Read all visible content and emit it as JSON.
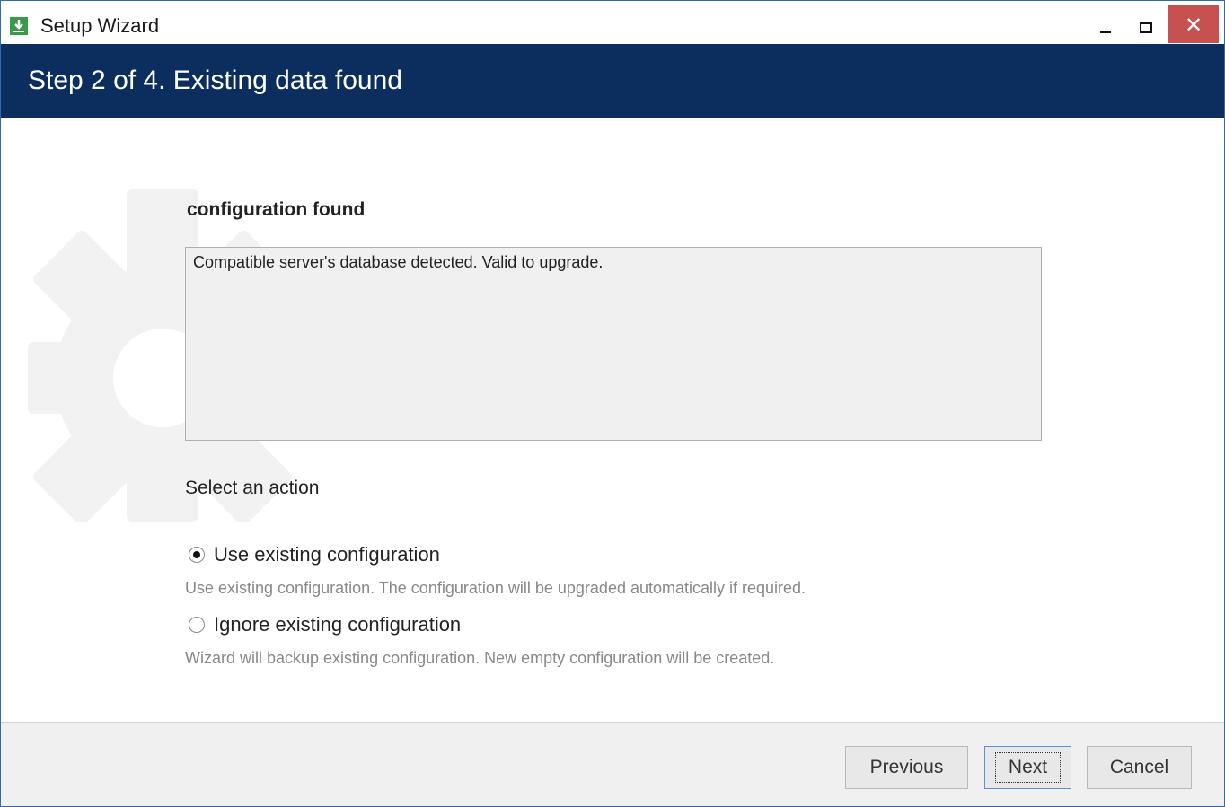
{
  "window": {
    "title": "Setup Wizard",
    "app_icon": "download-icon",
    "controls": {
      "minimize": "minimize-icon",
      "maximize": "maximize-icon",
      "close": "✕"
    }
  },
  "header": {
    "title": "Step 2 of 4. Existing data found",
    "background": "#0c2e5f"
  },
  "main": {
    "section_title": "configuration found",
    "info_text": "Compatible server's database detected. Valid to upgrade.",
    "select_label": "Select an action",
    "options": [
      {
        "label": "Use existing configuration",
        "description": "Use existing configuration. The configuration will be upgraded automatically if required.",
        "selected": true
      },
      {
        "label": "Ignore existing configuration",
        "description": "Wizard will backup existing configuration. New empty configuration will be created.",
        "selected": false
      }
    ]
  },
  "footer": {
    "previous": "Previous",
    "next": "Next",
    "cancel": "Cancel"
  },
  "colors": {
    "accent": "#0c2e5f",
    "close": "#c75050"
  }
}
